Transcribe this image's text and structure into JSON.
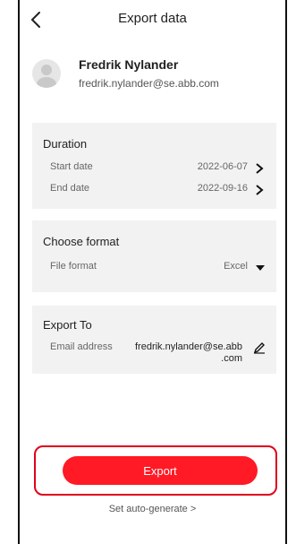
{
  "header": {
    "title": "Export data"
  },
  "user": {
    "name": "Fredrik Nylander",
    "email": "fredrik.nylander@se.abb.com"
  },
  "duration": {
    "title": "Duration",
    "start_label": "Start date",
    "start_value": "2022-06-07",
    "end_label": "End date",
    "end_value": "2022-09-16"
  },
  "format": {
    "title": "Choose format",
    "file_label": "File format",
    "file_value": "Excel"
  },
  "export_to": {
    "title": "Export To",
    "email_label": "Email address",
    "email_line1": "fredrik.nylander@se.abb",
    "email_line2": ".com"
  },
  "actions": {
    "export_label": "Export",
    "auto_generate_label": "Set auto-generate >"
  },
  "colors": {
    "accent": "#ff1a25",
    "highlight_border": "#e0001b",
    "card_bg": "#f2f2f2"
  },
  "icons": [
    "back-chevron-icon",
    "chevron-right-icon",
    "dropdown-triangle-icon",
    "edit-pencil-icon",
    "avatar-placeholder-icon"
  ]
}
